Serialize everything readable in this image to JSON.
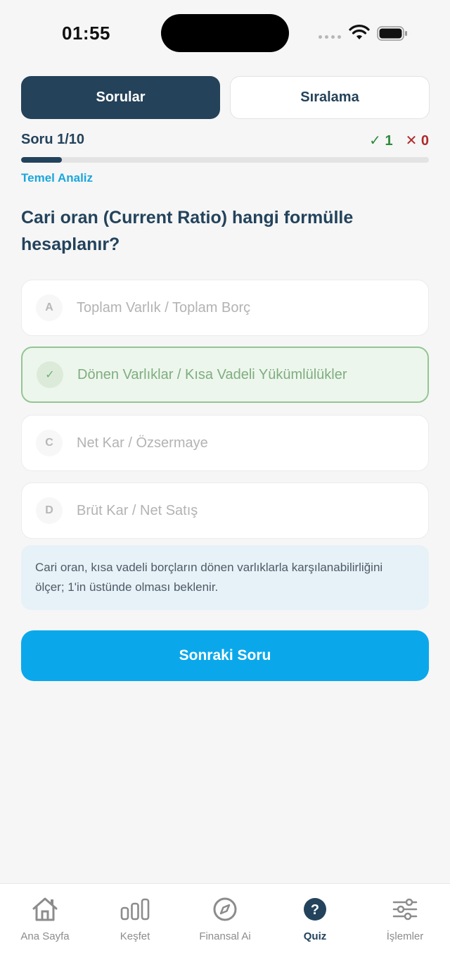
{
  "status_bar": {
    "time": "01:55"
  },
  "segments": {
    "active": "Sorular",
    "inactive": "Sıralama"
  },
  "progress": {
    "counter": "Soru 1/10",
    "fraction": 0.1,
    "correct": "✓ 1",
    "wrong": "✕ 0"
  },
  "category": "Temel Analiz",
  "question": "Cari oran (Current Ratio) hangi formülle hesaplanır?",
  "options": [
    {
      "letter": "A",
      "text": "Toplam Varlık / Toplam Borç"
    },
    {
      "letter": "✓",
      "text": "Dönen Varlıklar / Kısa Vadeli Yükümlülükler"
    },
    {
      "letter": "C",
      "text": "Net Kar / Özsermaye"
    },
    {
      "letter": "D",
      "text": "Brüt Kar / Net Satış"
    }
  ],
  "explanation": "Cari oran, kısa vadeli borçların dönen varlıklarla karşılanabilirliğini ölçer; 1'in üstünde olması beklenir.",
  "next_button": "Sonraki Soru",
  "tabbar": [
    {
      "label": "Ana Sayfa",
      "icon": "home-icon"
    },
    {
      "label": "Keşfet",
      "icon": "bar-chart-icon"
    },
    {
      "label": "Finansal Ai",
      "icon": "compass-icon"
    },
    {
      "label": "Quiz",
      "icon": "question-icon"
    },
    {
      "label": "İşlemler",
      "icon": "sliders-icon"
    }
  ],
  "colors": {
    "primary": "#244259",
    "accent": "#0aa8eb",
    "correct": "#2e8b3a",
    "wrong": "#b02a2a",
    "category": "#1aa7dd"
  }
}
